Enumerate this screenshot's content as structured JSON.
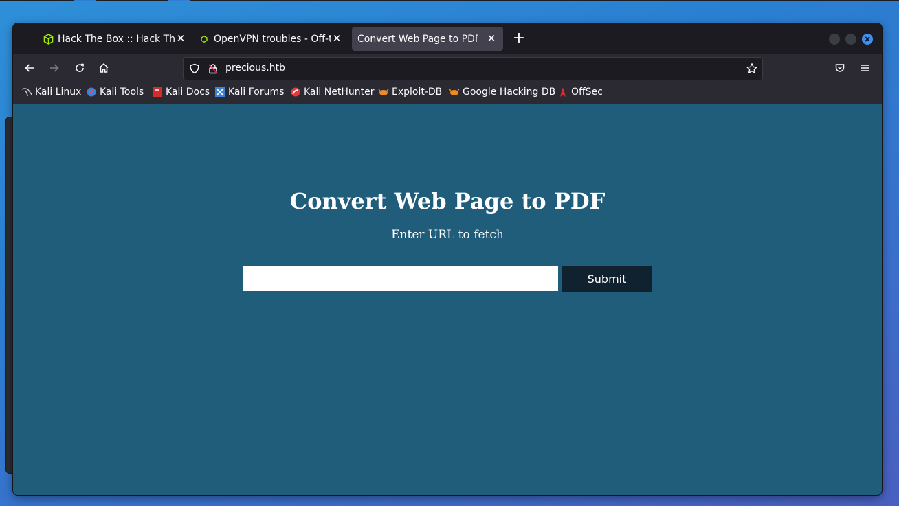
{
  "browser": {
    "tabs": [
      {
        "title": "Hack The Box :: Hack The Box",
        "close": "✕"
      },
      {
        "title": "OpenVPN troubles - Off-topic",
        "close": "✕"
      },
      {
        "title": "Convert Web Page to PDF",
        "close": "✕",
        "active": true
      }
    ],
    "new_tab": "+",
    "url": "precious.htb",
    "bookmarks": [
      {
        "label": "Kali Linux"
      },
      {
        "label": "Kali Tools"
      },
      {
        "label": "Kali Docs"
      },
      {
        "label": "Kali Forums"
      },
      {
        "label": "Kali NetHunter"
      },
      {
        "label": "Exploit-DB"
      },
      {
        "label": "Google Hacking DB"
      },
      {
        "label": "OffSec"
      }
    ]
  },
  "page": {
    "title": "Convert Web Page to PDF",
    "subtitle": "Enter URL to fetch",
    "input_value": "",
    "submit_label": "Submit"
  },
  "colors": {
    "page_background": "#1f5d7a",
    "submit_background": "#10222f",
    "accent": "#3f8ff0"
  }
}
